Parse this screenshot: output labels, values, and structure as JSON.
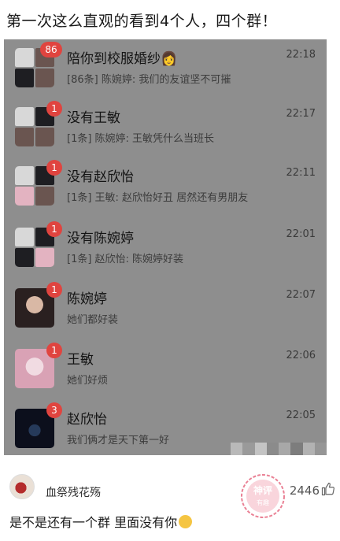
{
  "caption": "第一次这么直观的看到4个人，四个群！",
  "chats": [
    {
      "title": "陪你到校服婚纱",
      "title_emoji": "👩",
      "badge": "86",
      "preview": "[86条] 陈婉婷: 我们的友谊坚不可摧",
      "time": "22:18",
      "avatar": "group"
    },
    {
      "title": "没有王敏",
      "badge": "1",
      "preview": "[1条] 陈婉婷: 王敏凭什么当班长",
      "time": "22:17",
      "avatar": "group"
    },
    {
      "title": "没有赵欣怡",
      "badge": "1",
      "preview": "[1条] 王敏: 赵欣怡好丑 居然还有男朋友",
      "time": "22:11",
      "avatar": "group"
    },
    {
      "title": "没有陈婉婷",
      "badge": "1",
      "preview": "[1条] 赵欣怡: 陈婉婷好装",
      "time": "22:01",
      "avatar": "group"
    },
    {
      "title": "陈婉婷",
      "badge": "1",
      "preview": "她们都好装",
      "time": "22:07",
      "avatar": "face"
    },
    {
      "title": "王敏",
      "badge": "1",
      "preview": "她们好烦",
      "time": "22:06",
      "avatar": "pink"
    },
    {
      "title": "赵欣怡",
      "badge": "3",
      "preview": "我们俩才是天下第一好",
      "time": "22:05",
      "avatar": "dark"
    }
  ],
  "comment": {
    "user": "血祭残花殇",
    "likes": "2446",
    "text": "是不是还有一个群 里面没有你",
    "emoji": "🤣"
  },
  "stamp": {
    "line1": "神评",
    "line2": "有趣"
  },
  "colors": {
    "badge": "#e0443f",
    "screenshot_bg": "#8e8e8e",
    "stamp": "#e5617a"
  }
}
